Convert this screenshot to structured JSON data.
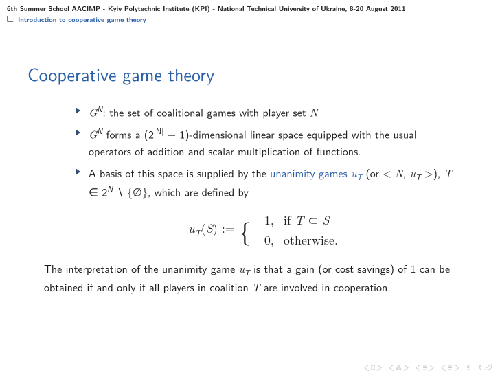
{
  "header": {
    "venue": "6th Summer School AACIMP - Kyiv Polytechnic Institute (KPI) - National Technical University of Ukraine, 8-20 August 2011",
    "section": "Introduction to cooperative game theory"
  },
  "title": "Cooperative game theory",
  "bullets": {
    "b1_pre": "G",
    "b1_sup": "N",
    "b1_post": ": the set of coalitional games with player set ",
    "b1_n": "N",
    "b2_pre": "G",
    "b2_sup": "N",
    "b2_mid1": " forms a (2",
    "b2_sup2": "|N|",
    "b2_mid2": " − 1)-dimensional linear space equipped with the usual operators of addition and scalar multiplication of functions.",
    "b3_a": "A basis of this space is supplied by the ",
    "b3_term": "unanimity games ",
    "b3_u": "u",
    "b3_T": "T",
    "b3_b1": " (or < ",
    "b3_N": "N",
    "b3_b2": ", ",
    "b3_u2": "u",
    "b3_T2": "T",
    "b3_b3": " >), ",
    "b3_Tset": "T",
    "b3_in": " ∈ 2",
    "b3_supN": "N",
    "b3_setminus": " ∖ {∅}, which are defined by"
  },
  "equation": {
    "lhs_u": "u",
    "lhs_T": "T",
    "lhs_S": "S",
    "lhs_def": ") := ",
    "case1_val": "1,",
    "case1_cond_pre": "if ",
    "case1_T": "T",
    "case1_sub": " ⊂ ",
    "case1_S": "S",
    "case0_val": "0,",
    "case0_cond": "otherwise."
  },
  "paragraph": {
    "p1": "The interpretation of the unanimity game ",
    "p_u": "u",
    "p_T": "T",
    "p2": " is that a gain (or cost savings) of 1 can be obtained if and only if all players in coalition ",
    "p_T2": "T",
    "p3": " are involved in cooperation."
  }
}
